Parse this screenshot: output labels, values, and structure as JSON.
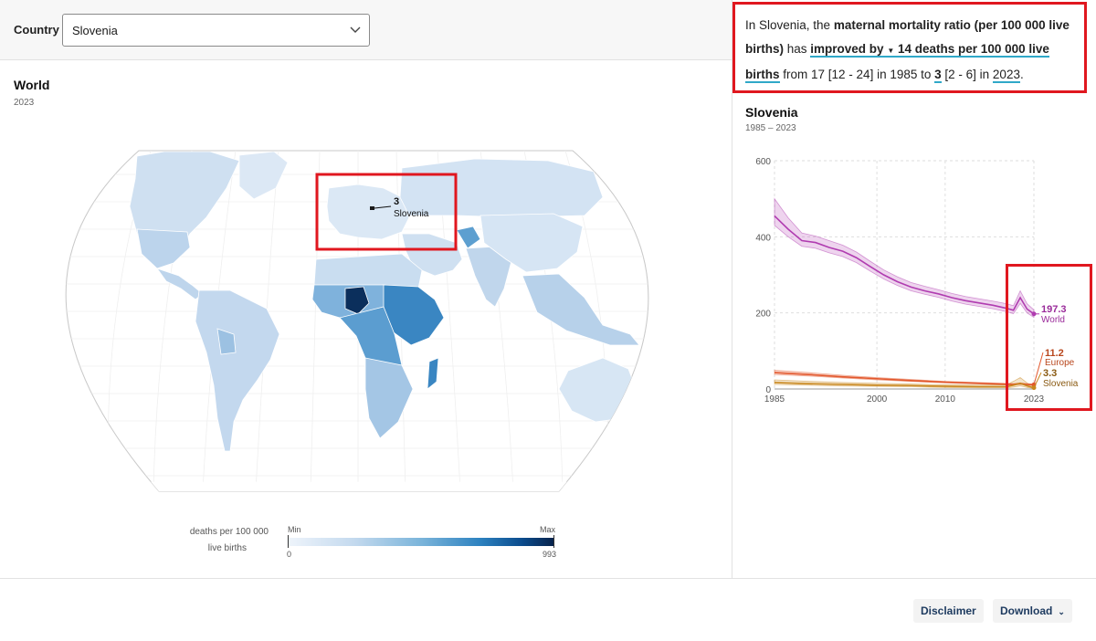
{
  "country_filter": {
    "label": "Country",
    "selected": "Slovenia"
  },
  "map": {
    "title": "World",
    "year": "2023",
    "highlight": {
      "value": "3",
      "name": "Slovenia"
    },
    "legend": {
      "unit_line1": "deaths per 100 000",
      "unit_line2": "live births",
      "min_label": "Min",
      "max_label": "Max",
      "min_value": "0",
      "max_value": "993",
      "colors": [
        "#eef4fb",
        "#c3d9ee",
        "#7ab4da",
        "#2d82c0",
        "#0b4b8c",
        "#08224a"
      ]
    }
  },
  "summary": {
    "prefix": "In Slovenia, the ",
    "indicator": "maternal mortality ratio (per 100 000 live births)",
    "has": " has ",
    "change_phrase": "improved by",
    "arrow": "▼",
    "change_amount": "14 deaths per 100 000 live births",
    "from": " from 17 [12 - 24] in 1985 to ",
    "current_value": "3",
    "current_ci": " [2 - 6] in ",
    "current_year": "2023",
    "suffix": "."
  },
  "trend_chart": {
    "title": "Slovenia",
    "range": "1985 – 2023"
  },
  "chart_data": {
    "type": "line",
    "title": "Slovenia",
    "subtitle": "1985 – 2023",
    "xlabel": "",
    "ylabel": "",
    "xlim": [
      1985,
      2023
    ],
    "ylim": [
      0,
      600
    ],
    "yticks": [
      "0",
      "200",
      "400",
      "600"
    ],
    "xticks": [
      "1985",
      "2000",
      "2010",
      "2023"
    ],
    "grid": true,
    "series": [
      {
        "name": "World",
        "end_label": "197.3",
        "color": "#b03cb0",
        "x": [
          1985,
          1987,
          1989,
          1991,
          1993,
          1995,
          1997,
          1999,
          2001,
          2003,
          2005,
          2007,
          2009,
          2011,
          2013,
          2015,
          2017,
          2019,
          2020,
          2021,
          2022,
          2023
        ],
        "y": [
          455,
          420,
          390,
          385,
          372,
          362,
          345,
          322,
          300,
          282,
          268,
          258,
          250,
          240,
          232,
          226,
          220,
          212,
          207,
          240,
          210,
          197.3
        ],
        "lower": [
          430,
          400,
          375,
          370,
          358,
          348,
          332,
          310,
          289,
          272,
          258,
          249,
          241,
          231,
          223,
          217,
          211,
          203,
          198,
          225,
          200,
          188
        ],
        "upper": [
          500,
          450,
          410,
          402,
          390,
          378,
          360,
          336,
          313,
          295,
          280,
          270,
          261,
          251,
          243,
          237,
          231,
          224,
          219,
          258,
          224,
          208
        ]
      },
      {
        "name": "Europe",
        "end_label": "11.2",
        "color": "#e2572c",
        "x": [
          1985,
          1990,
          1995,
          2000,
          2005,
          2010,
          2015,
          2020,
          2021,
          2022,
          2023
        ],
        "y": [
          43,
          38,
          32,
          27,
          22,
          18,
          15,
          12,
          14,
          12,
          11.2
        ],
        "lower": [
          38,
          34,
          29,
          24,
          20,
          16,
          13,
          10,
          12,
          10,
          9
        ],
        "upper": [
          49,
          43,
          36,
          30,
          25,
          20,
          17,
          14,
          16,
          14,
          13
        ]
      },
      {
        "name": "Slovenia",
        "end_label": "3.3",
        "color": "#c9881f",
        "x": [
          1985,
          1990,
          1995,
          2000,
          2005,
          2010,
          2015,
          2019,
          2020,
          2021,
          2022,
          2023
        ],
        "y": [
          17,
          14,
          12,
          10,
          9,
          7,
          6,
          6,
          10,
          15,
          8,
          3.3
        ],
        "lower": [
          12,
          10,
          8,
          7,
          6,
          4,
          3,
          3,
          5,
          8,
          4,
          2
        ],
        "upper": [
          24,
          20,
          17,
          15,
          13,
          11,
          10,
          11,
          20,
          30,
          16,
          6
        ]
      }
    ]
  },
  "footer": {
    "disclaimer": "Disclaimer",
    "download": "Download",
    "download_chevron": "⌄"
  }
}
